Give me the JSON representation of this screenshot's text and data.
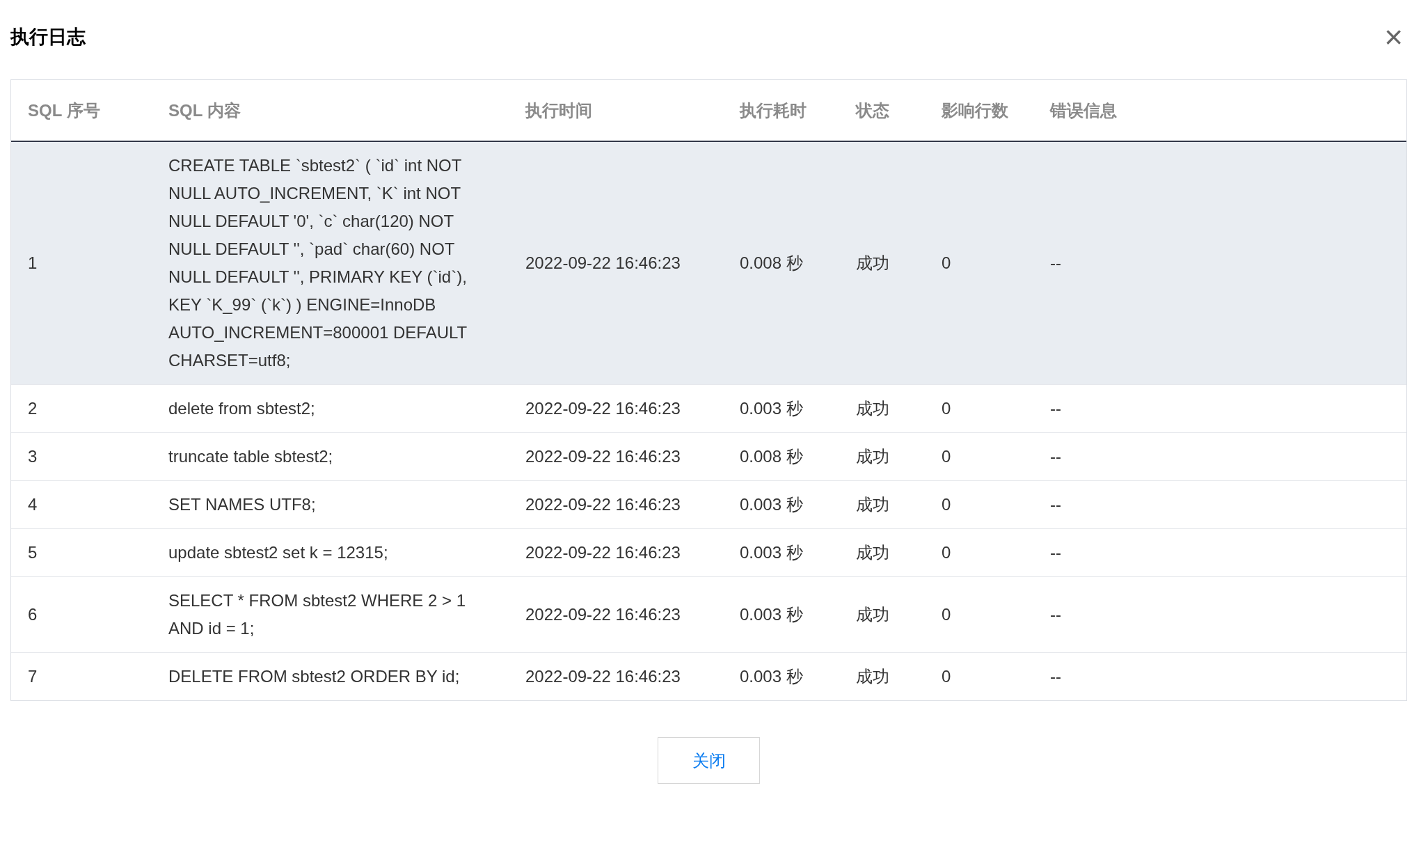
{
  "dialog": {
    "title": "执行日志",
    "close_label": "×"
  },
  "table": {
    "columns": [
      "SQL 序号",
      "SQL 内容",
      "执行时间",
      "执行耗时",
      "状态",
      "影响行数",
      "错误信息"
    ],
    "rows": [
      {
        "selected": true,
        "cells": [
          "1",
          "CREATE TABLE `sbtest2` ( `id` int NOT NULL AUTO_INCREMENT, `K` int NOT NULL DEFAULT '0', `c` char(120) NOT NULL DEFAULT '', `pad` char(60) NOT NULL DEFAULT '', PRIMARY KEY (`id`), KEY `K_99` (`k`) ) ENGINE=InnoDB AUTO_INCREMENT=800001 DEFAULT CHARSET=utf8;",
          "2022-09-22 16:46:23",
          "0.008 秒",
          "成功",
          "0",
          "--"
        ]
      },
      {
        "selected": false,
        "cells": [
          "2",
          "delete from sbtest2;",
          "2022-09-22 16:46:23",
          "0.003 秒",
          "成功",
          "0",
          "--"
        ]
      },
      {
        "selected": false,
        "cells": [
          "3",
          "truncate table sbtest2;",
          "2022-09-22 16:46:23",
          "0.008 秒",
          "成功",
          "0",
          "--"
        ]
      },
      {
        "selected": false,
        "cells": [
          "4",
          "SET NAMES UTF8;",
          "2022-09-22 16:46:23",
          "0.003 秒",
          "成功",
          "0",
          "--"
        ]
      },
      {
        "selected": false,
        "cells": [
          "5",
          "update sbtest2 set k = 12315;",
          "2022-09-22 16:46:23",
          "0.003 秒",
          "成功",
          "0",
          "--"
        ]
      },
      {
        "selected": false,
        "cells": [
          "6",
          "SELECT * FROM sbtest2 WHERE 2 > 1 AND id = 1;",
          "2022-09-22 16:46:23",
          "0.003 秒",
          "成功",
          "0",
          "--"
        ]
      },
      {
        "selected": false,
        "cells": [
          "7",
          "DELETE FROM sbtest2 ORDER BY id;",
          "2022-09-22 16:46:23",
          "0.003 秒",
          "成功",
          "0",
          "--"
        ]
      }
    ]
  },
  "buttons": [
    "关闭"
  ]
}
